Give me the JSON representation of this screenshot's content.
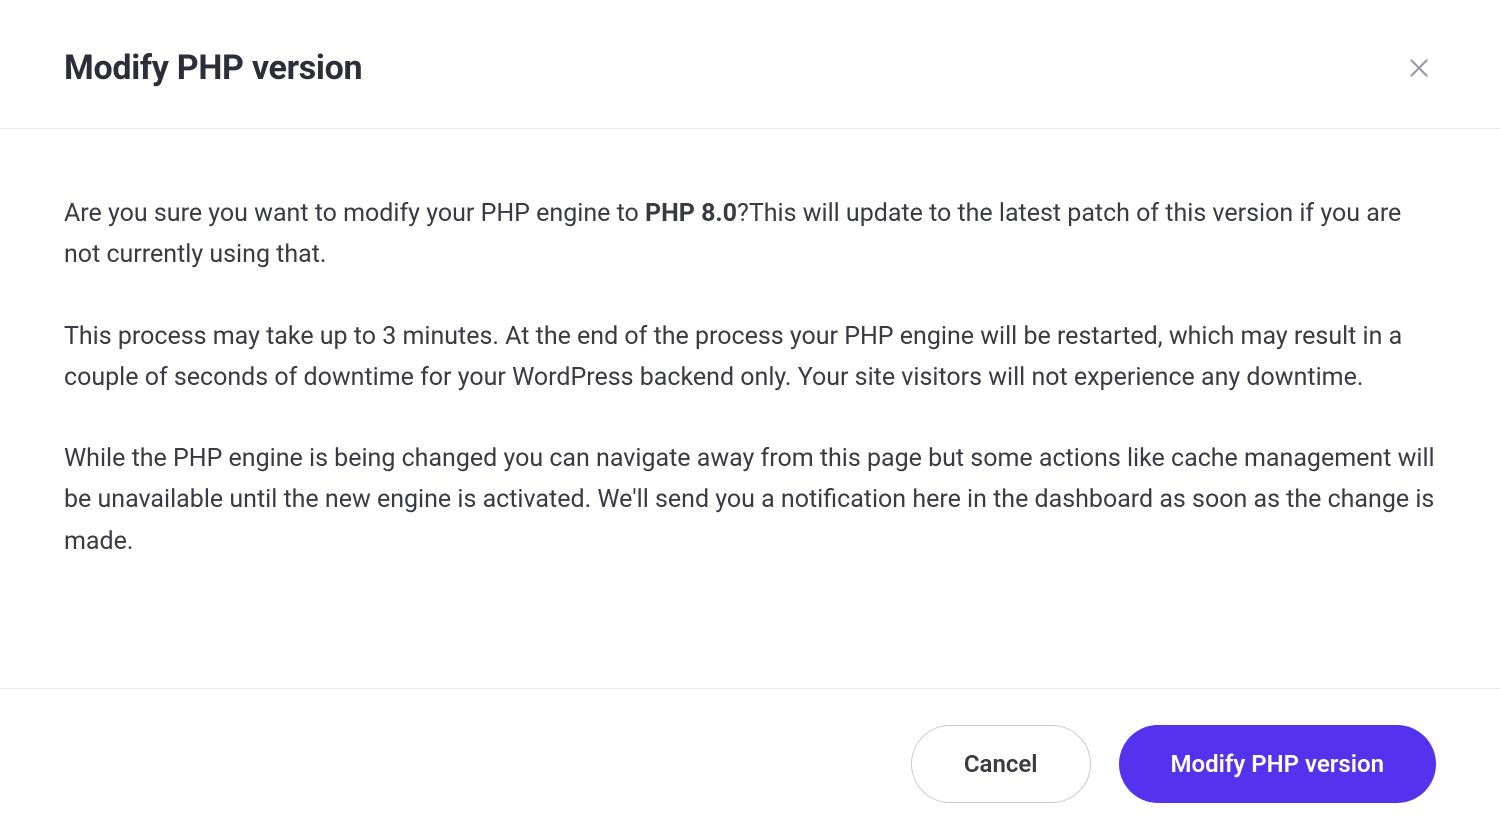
{
  "dialog": {
    "title": "Modify PHP version",
    "paragraph1_prefix": "Are you sure you want to modify your PHP engine to ",
    "paragraph1_bold": "PHP 8.0",
    "paragraph1_suffix": "?This will update to the latest patch of this version if you are not currently using that.",
    "paragraph2": "This process may take up to 3 minutes. At the end of the process your PHP engine will be restarted, which may result in a couple of seconds of downtime for your WordPress backend only. Your site visitors will not experience any downtime.",
    "paragraph3": "While the PHP engine is being changed you can navigate away from this page but some actions like cache management will be unavailable until the new engine is activated. We'll send you a notification here in the dashboard as soon as the change is made."
  },
  "actions": {
    "cancel_label": "Cancel",
    "confirm_label": "Modify PHP version"
  }
}
